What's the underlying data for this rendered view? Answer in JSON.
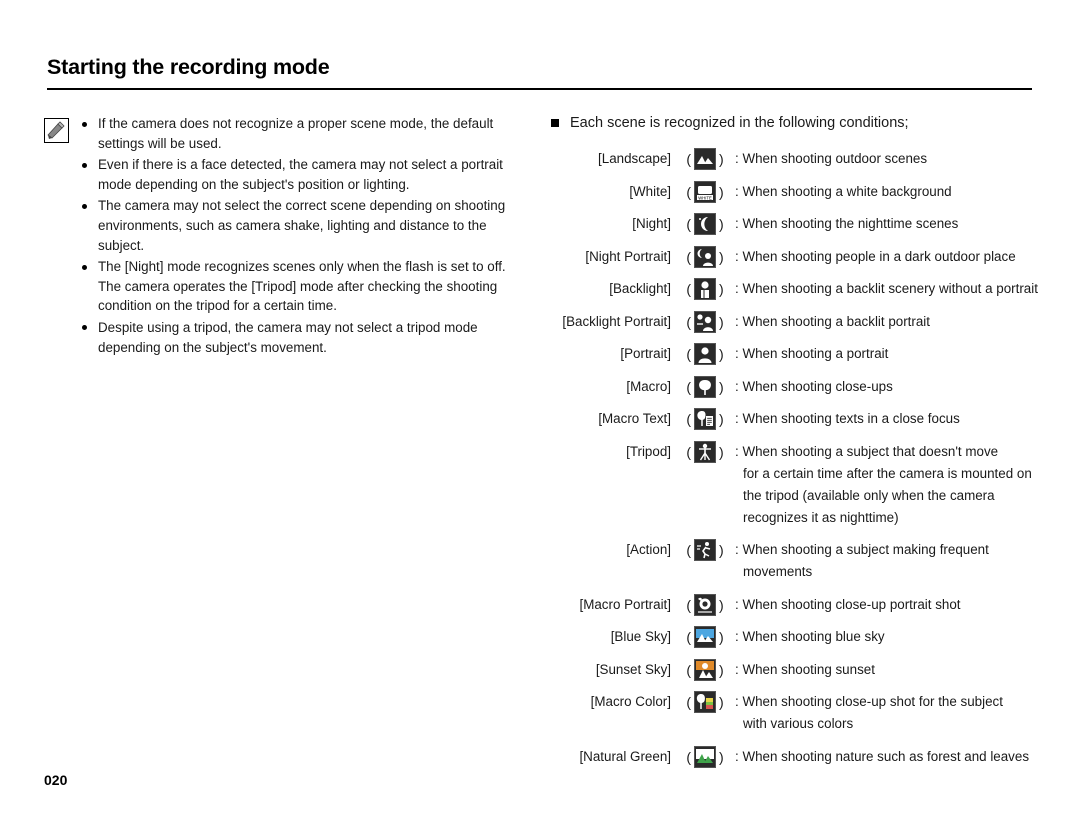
{
  "document": {
    "title": "Starting the recording mode",
    "page_number": "020"
  },
  "left": {
    "note_icon": "note-pencil-icon",
    "bullets": [
      "If the camera does not recognize a proper scene mode, the default settings will be used.",
      "Even if there is a face detected, the camera may not select a portrait mode depending on the subject's position or lighting.",
      "The camera may not select the correct scene depending on shooting environments, such as camera shake, lighting and distance to the subject.",
      "The [Night] mode recognizes scenes only when the flash is set to off. The camera operates the [Tripod] mode after checking the shooting condition on the tripod for a certain time.",
      "Despite using a tripod, the camera may not select a tripod mode depending on the subject's movement."
    ]
  },
  "right": {
    "heading": "Each scene is recognized in the following conditions;",
    "scenes": [
      {
        "label": "[Landscape]",
        "icon": "landscape-icon",
        "desc": ": When shooting outdoor scenes",
        "desc2": ""
      },
      {
        "label": "[White]",
        "icon": "white-balance-icon",
        "desc": ": When shooting a white background",
        "desc2": ""
      },
      {
        "label": "[Night]",
        "icon": "night-icon",
        "desc": ": When shooting the nighttime scenes",
        "desc2": ""
      },
      {
        "label": "[Night Portrait]",
        "icon": "night-portrait-icon",
        "desc": ": When shooting people in a dark outdoor place",
        "desc2": ""
      },
      {
        "label": "[Backlight]",
        "icon": "backlight-icon",
        "desc": ": When shooting a backlit scenery without a portrait",
        "desc2": ""
      },
      {
        "label": "[Backlight Portrait]",
        "icon": "backlight-portrait-icon",
        "desc": ": When shooting a backlit portrait",
        "desc2": ""
      },
      {
        "label": "[Portrait]",
        "icon": "portrait-icon",
        "desc": ": When shooting a portrait",
        "desc2": ""
      },
      {
        "label": "[Macro]",
        "icon": "macro-icon",
        "desc": ": When shooting close-ups",
        "desc2": ""
      },
      {
        "label": "[Macro Text]",
        "icon": "macro-text-icon",
        "desc": ": When shooting texts in a close focus",
        "desc2": ""
      },
      {
        "label": "[Tripod]",
        "icon": "tripod-icon",
        "desc": ": When shooting a subject that doesn't move",
        "desc2": "for a certain time after the camera is mounted on the tripod (available only when the camera recognizes it as nighttime)"
      },
      {
        "label": "[Action]",
        "icon": "action-icon",
        "desc": ": When shooting a subject making frequent",
        "desc2": "movements"
      },
      {
        "label": "[Macro Portrait]",
        "icon": "macro-portrait-icon",
        "desc": ": When shooting close-up portrait shot",
        "desc2": ""
      },
      {
        "label": "[Blue Sky]",
        "icon": "blue-sky-icon",
        "desc": ": When shooting blue sky",
        "desc2": ""
      },
      {
        "label": "[Sunset Sky]",
        "icon": "sunset-sky-icon",
        "desc": ": When shooting sunset",
        "desc2": ""
      },
      {
        "label": "[Macro Color]",
        "icon": "macro-color-icon",
        "desc": ": When shooting close-up shot for the subject",
        "desc2": "with various colors"
      },
      {
        "label": "[Natural Green]",
        "icon": "natural-green-icon",
        "desc": ": When shooting nature such as forest and leaves",
        "desc2": ""
      }
    ]
  }
}
